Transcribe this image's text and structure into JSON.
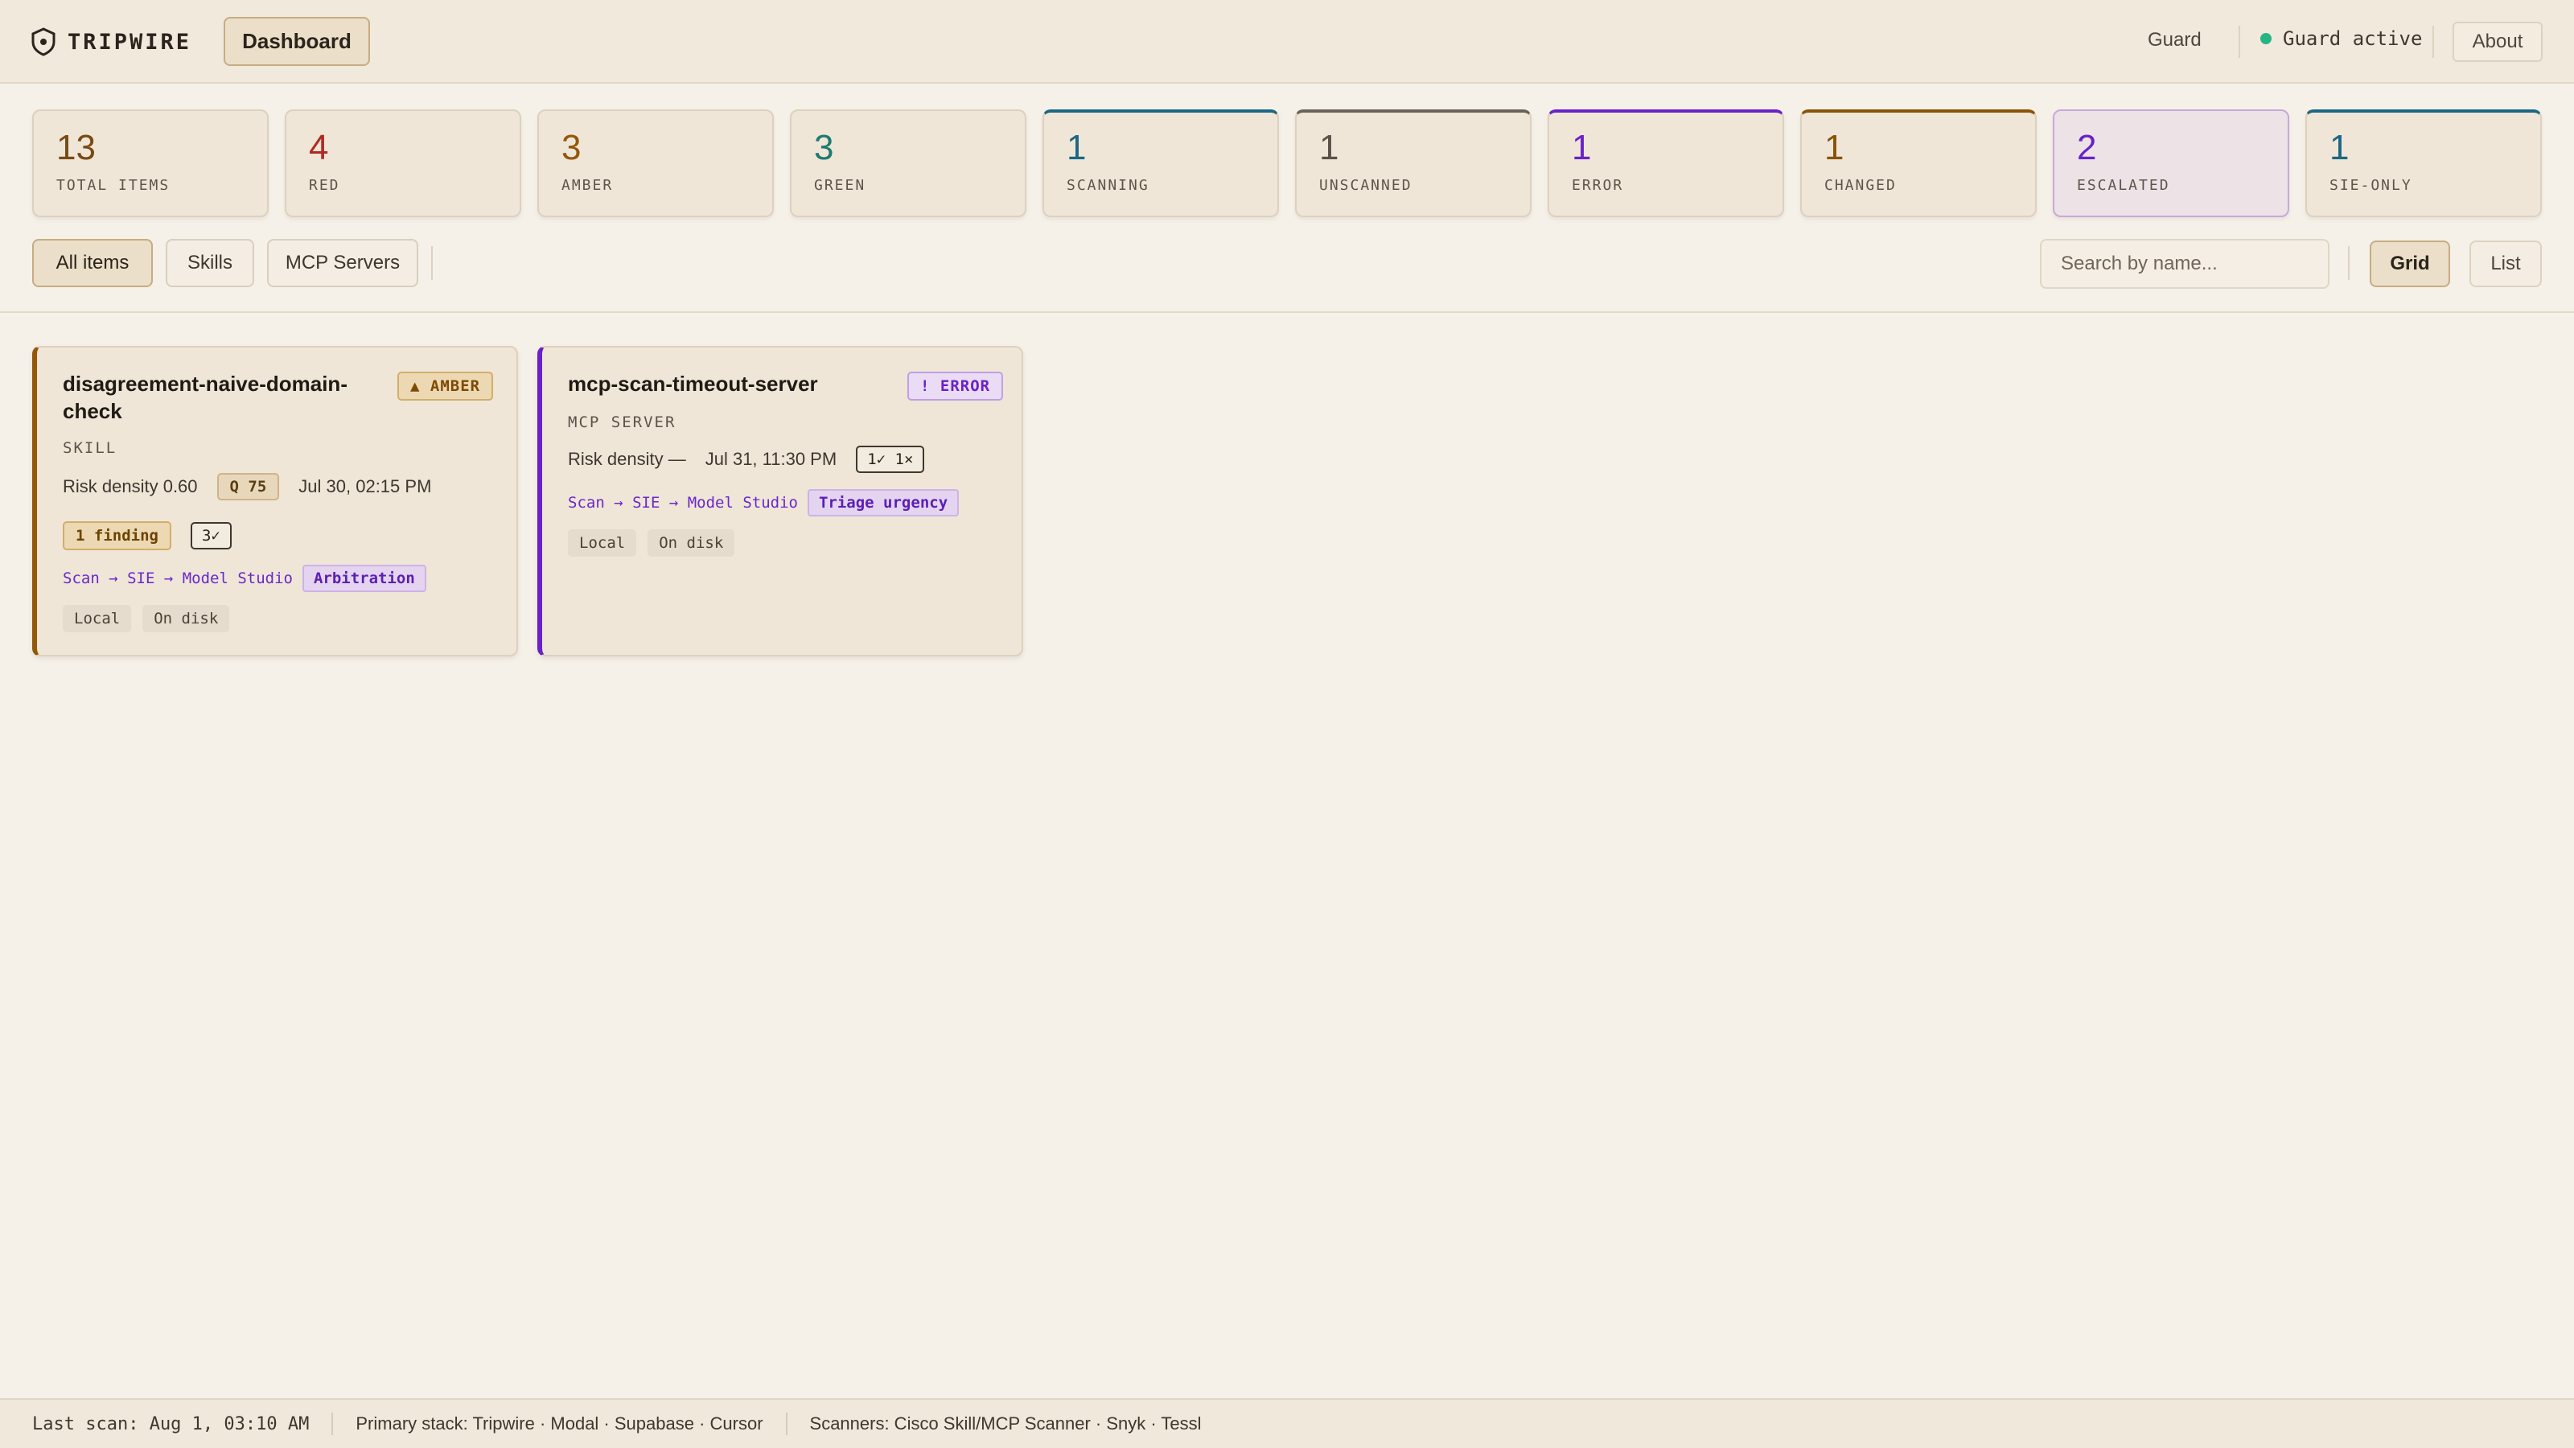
{
  "app": {
    "name": "TRIPWIRE",
    "logo_icon": "shield-icon"
  },
  "nav": {
    "dashboard_label": "Dashboard",
    "guard_label": "Guard",
    "guard_status": "Guard active",
    "guard_status_color": "#25b584",
    "about_label": "About"
  },
  "stats": [
    {
      "value": "13",
      "label": "TOTAL ITEMS",
      "color": "#7a4a12"
    },
    {
      "value": "4",
      "label": "RED",
      "color": "#b02a22"
    },
    {
      "value": "3",
      "label": "AMBER",
      "color": "#94570a"
    },
    {
      "value": "3",
      "label": "GREEN",
      "color": "#1f7a6f"
    },
    {
      "value": "1",
      "label": "SCANNING",
      "color": "#1b6784",
      "accent": "#1b6784"
    },
    {
      "value": "1",
      "label": "UNSCANNED",
      "color": "#5a5248",
      "accent": "#6a6258"
    },
    {
      "value": "1",
      "label": "ERROR",
      "color": "#6a21c8",
      "accent": "#6a21c8"
    },
    {
      "value": "1",
      "label": "CHANGED",
      "color": "#8a5208",
      "accent": "#8a5208"
    },
    {
      "value": "2",
      "label": "ESCALATED",
      "color": "#6a21c8"
    },
    {
      "value": "1",
      "label": "SIE-ONLY",
      "color": "#1b6784",
      "accent": "#1b6784"
    }
  ],
  "filters": {
    "all": "All items",
    "skills": "Skills",
    "mcp": "MCP Servers"
  },
  "search": {
    "placeholder": "Search by name..."
  },
  "view": {
    "grid": "Grid",
    "list": "List"
  },
  "cards": [
    {
      "title": "disagreement-naive-domain-check",
      "badge": "▲ AMBER",
      "kind": "SKILL",
      "risk": "Risk density 0.60",
      "q": "Q 75",
      "date": "Jul 30, 02:15 PM",
      "finding": "1 finding",
      "checks": "3✓",
      "pipeline": "Scan → SIE → Model Studio",
      "tag": "Arbitration",
      "location": "Local",
      "storage": "On disk",
      "accent": "#94570a"
    },
    {
      "title": "mcp-scan-timeout-server",
      "badge": "! ERROR",
      "kind": "MCP SERVER",
      "risk": "Risk density —",
      "date": "Jul 31, 11:30 PM",
      "checks": "1✓ 1×",
      "pipeline": "Scan → SIE → Model Studio",
      "tag": "Triage urgency",
      "location": "Local",
      "storage": "On disk",
      "accent": "#6a21c8"
    }
  ],
  "footer": {
    "last_scan": "Last scan: Aug 1, 03:10 AM",
    "stack": "Primary stack: Tripwire · Modal · Supabase · Cursor",
    "scanners": "Scanners: Cisco Skill/MCP Scanner · Snyk · Tessl"
  }
}
